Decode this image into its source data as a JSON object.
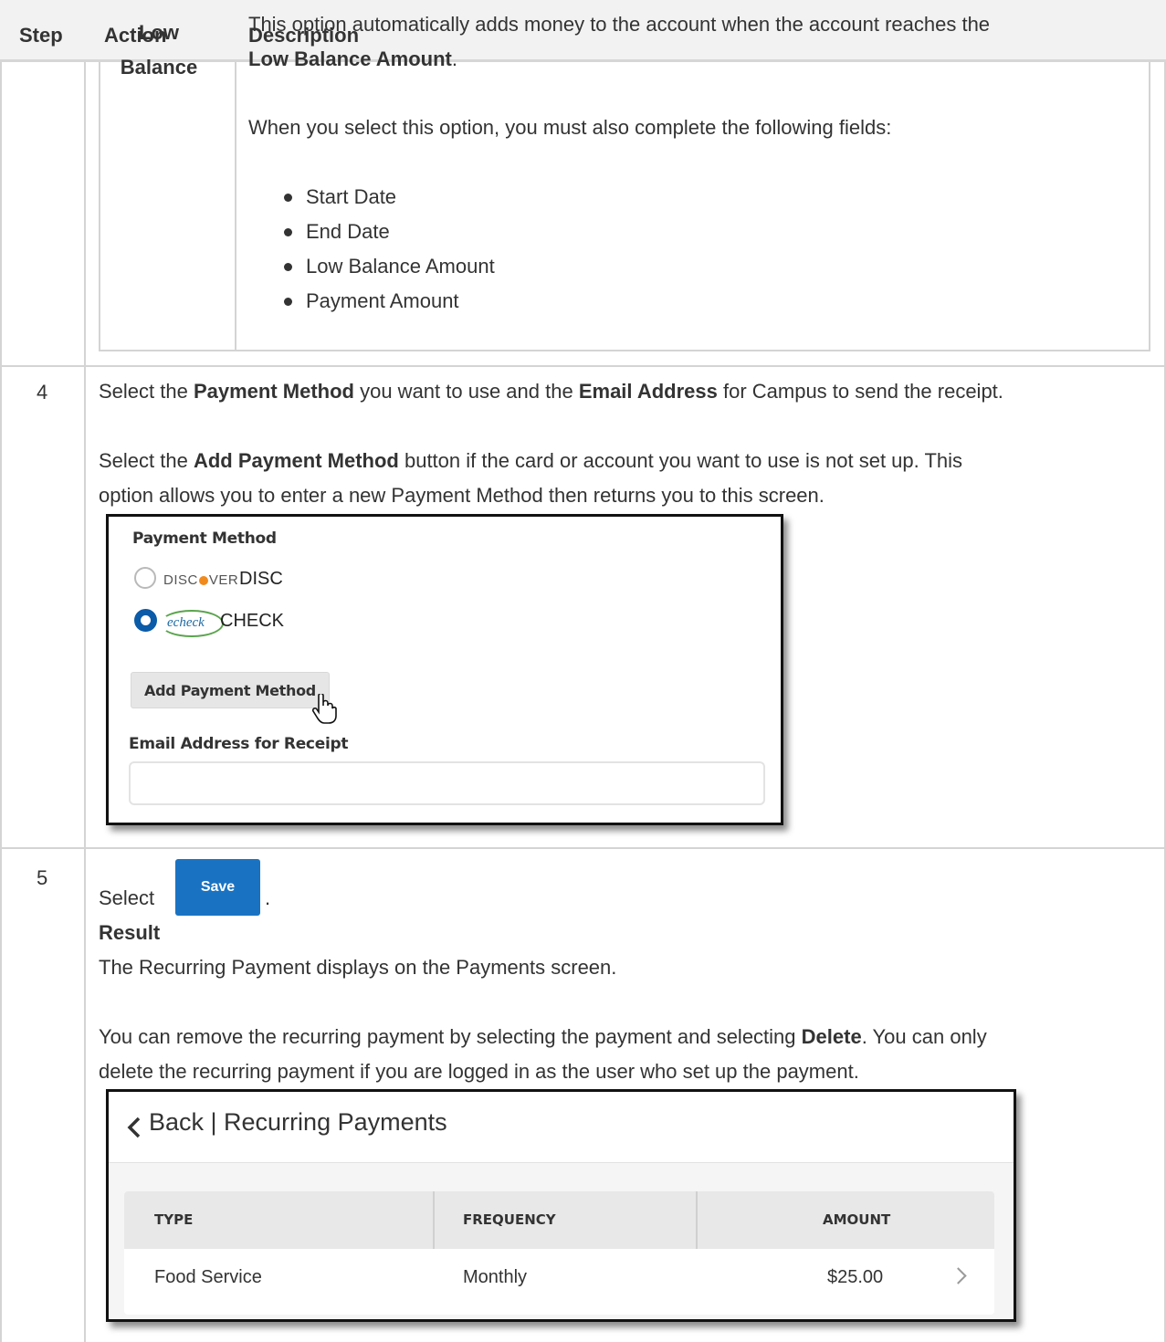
{
  "header": {
    "step": "Step",
    "action": "Action",
    "option": "Low Balance",
    "description": "Description"
  },
  "option_row": {
    "intro_text": "This option automatically adds money to the account when the account reaches the",
    "intro_bold": "Low Balance Amount",
    "intro_end": ".",
    "fields_intro": "When you select this option, you must also complete the following fields:",
    "fields": [
      "Start Date",
      "End Date",
      "Low Balance Amount",
      "Payment Amount"
    ]
  },
  "step4": {
    "number": "4",
    "p1_a": "Select the ",
    "p1_b": "Payment Method",
    "p1_c": " you want to use and the ",
    "p1_d": "Email Address",
    "p1_e": " for Campus to send the receipt.",
    "p2_a": "Select the ",
    "p2_b": "Add Payment Method",
    "p2_c": " button if the card or account you want to use is not set up. This",
    "p2_d": "option allows you to enter a new Payment Method then returns you to this screen.",
    "screenshot": {
      "payment_method_label": "Payment Method",
      "discover_logo": "DISC VER",
      "discover_name": "DISC",
      "echeck_logo": "echeck",
      "check_name": "CHECK",
      "add_button": "Add Payment Method",
      "email_label": "Email Address for Receipt",
      "email_value": ""
    }
  },
  "step5": {
    "number": "5",
    "select": "Select",
    "save_button": "Save",
    "period": ".",
    "result_label": "Result",
    "result_text": "The Recurring Payment displays on the Payments screen.",
    "p2_a": "You can remove the recurring payment by selecting the payment and selecting ",
    "p2_b": "Delete",
    "p2_c": ". You can only",
    "p2_d": "delete the recurring payment if you are logged in as the user who set up the payment.",
    "screenshot": {
      "title": "Back | Recurring Payments",
      "columns": [
        "TYPE",
        "FREQUENCY",
        "AMOUNT"
      ],
      "row": {
        "type": "Food Service",
        "frequency": "Monthly",
        "amount": "$25.00"
      }
    }
  }
}
